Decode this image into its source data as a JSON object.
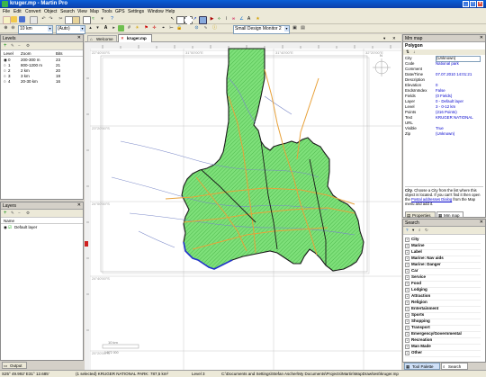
{
  "window": {
    "title": "kruger.mp - Martin Pro",
    "minimize": "_",
    "maximize": "□",
    "close": "×"
  },
  "menu": [
    "File",
    "Edit",
    "Convert",
    "Object",
    "Search",
    "View",
    "Map",
    "Tools",
    "GPS",
    "Settings",
    "Window",
    "Help"
  ],
  "toolbar": {
    "zoom_value": "10 km",
    "auto_value": "(Auto)",
    "design_value": "Small Design Monitor 2"
  },
  "levels": {
    "title": "Levels",
    "columns": [
      "Level",
      "Zoom",
      "Bits"
    ],
    "rows": [
      {
        "level": "0",
        "zoom": "200-300 m",
        "bits": "23"
      },
      {
        "level": "1",
        "zoom": "800-1200 m",
        "bits": "21"
      },
      {
        "level": "2",
        "zoom": "2 km",
        "bits": "20"
      },
      {
        "level": "3",
        "zoom": "3 km",
        "bits": "19"
      },
      {
        "level": "4",
        "zoom": "20-30 km",
        "bits": "16"
      }
    ]
  },
  "layers": {
    "title": "Layers",
    "column": "Name",
    "rows": [
      "Default layer"
    ]
  },
  "output_tab": "Output",
  "tabs": {
    "welcome": "Welcome",
    "kruger": "kruger.mp"
  },
  "map": {
    "lat_labels": [
      "22°40'00\"S",
      "23°20'00\"S",
      "24°00'00\"S",
      "24°40'00\"S",
      "25°20'00\"S"
    ],
    "lon_labels": [
      "30°20'00\"E",
      "31°00'00\"E",
      "31°40'00\"E",
      "32°20'00\"E"
    ],
    "scale_text": "10 km",
    "scale_sub": "1:872 000",
    "compass": "N"
  },
  "properties": {
    "panel_title": "Mm map",
    "object": "Polygon",
    "rows": [
      {
        "name": "City",
        "value": "(Unknown)"
      },
      {
        "name": "Code",
        "value": "National park"
      },
      {
        "name": "Comment",
        "value": ""
      },
      {
        "name": "Date/Time",
        "value": "07.07.2010 14:01:21"
      },
      {
        "name": "Description",
        "value": ""
      },
      {
        "name": "Elevation",
        "value": "0"
      },
      {
        "name": "EndsInIndex",
        "value": "False"
      },
      {
        "name": "Fields",
        "value": "(0 Fields)"
      },
      {
        "name": "Layer",
        "value": "0 - Default layer"
      },
      {
        "name": "Level",
        "value": "3 - 0-12 km"
      },
      {
        "name": "Points",
        "value": "(216 Points)"
      },
      {
        "name": "Text",
        "value": "KRUGER NATIONAL"
      },
      {
        "name": "URL",
        "value": ""
      },
      {
        "name": "Visible",
        "value": "True"
      },
      {
        "name": "Zip",
        "value": "(Unknown)"
      }
    ],
    "help_bold": "City",
    "help_text": "Choose a City from the list where this object is located. If you can't find it then open the",
    "help_link": "Postal addresses Dialog",
    "help_tail": "from the Map menu and add it.",
    "tab_properties": "Properties",
    "tab_mmmap": "Mm map"
  },
  "search": {
    "title": "Search",
    "items": [
      "City",
      "Marine",
      "Label",
      "Marine: Nav aids",
      "Marine: Danger",
      "Car",
      "Service",
      "Food",
      "Lodging",
      "Attraction",
      "Religion",
      "Entertainment",
      "Sports",
      "Shopping",
      "Transport",
      "Emergency/Governmental",
      "Recreation",
      "Man Made",
      "Other"
    ],
    "tab_tool_palette": "Tool Palette",
    "tab_search": "Search"
  },
  "status": {
    "coords": "S25° 49.992' E31° 12.685'",
    "selection": "(1 selected) KRUGER NATIONAL PARK: 787,5 km²",
    "level": "Level 3",
    "path": "C:\\Documents and Settings\\Stefan Ascher\\My Documents\\Projects\\Martin\\MapDraw\\test\\kruger.mp"
  },
  "colors": {
    "park_fill": "#7ee07a",
    "park_edge": "#2f8f2f",
    "border": "#1a1a1a",
    "road": "#e8a13a",
    "river": "#7a88c8",
    "coast": "#2233cc",
    "accent": "#0b3faa"
  }
}
